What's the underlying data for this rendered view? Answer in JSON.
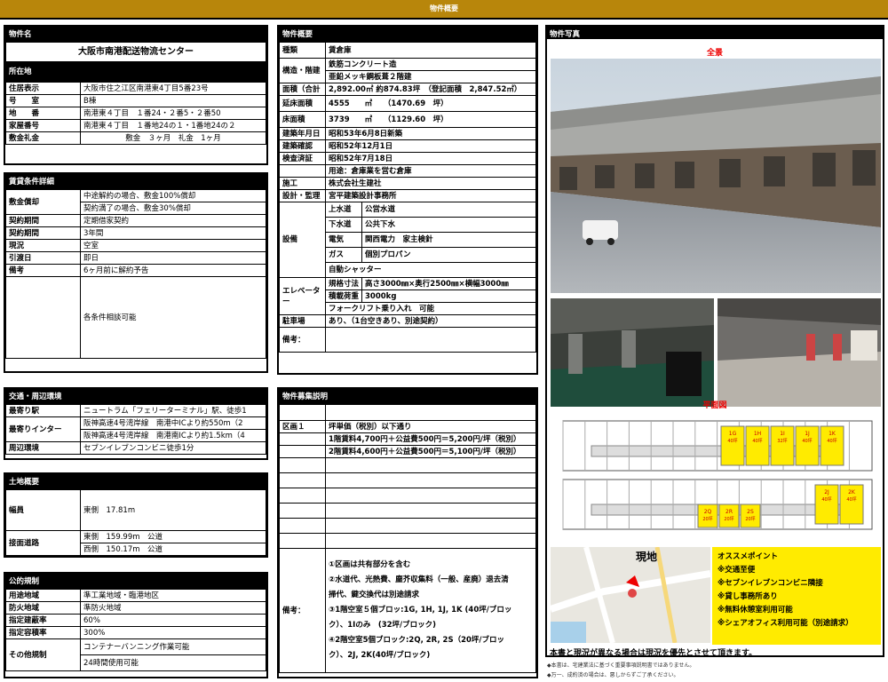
{
  "header": {
    "title": "物件概要"
  },
  "property_name": {
    "label": "物件名",
    "value": "大阪市南港配送物流センター"
  },
  "location": {
    "label": "所在地",
    "rows": [
      {
        "label": "住居表示",
        "value": "大阪市住之江区南港東4丁目5番23号"
      },
      {
        "label": "号　　室",
        "value": "B棟"
      },
      {
        "label": "地　　番",
        "value": "南港東４丁目　１番24・２番5・２番50"
      },
      {
        "label": "家屋番号",
        "value": "南港東４丁目　１番地24の１・1番地24の２"
      },
      {
        "label": "敷金礼金",
        "value": "敷金　３ヶ月　礼金　1ヶ月"
      }
    ]
  },
  "lease": {
    "title": "賃貸条件詳細",
    "deposit_label": "敷金償却",
    "deposit_lines": [
      "中途解約の場合、敷金100%償却",
      "契約満了の場合、敷金30%償却"
    ],
    "rows": [
      {
        "label": "契約期間",
        "value": "定期借家契約"
      },
      {
        "label": "契約期間",
        "value": "3年間"
      },
      {
        "label": "現況",
        "value": "空室"
      },
      {
        "label": "引渡日",
        "value": "即日"
      },
      {
        "label": "備考",
        "value": "6ヶ月前に解約予告"
      }
    ],
    "consult": "各条件相談可能"
  },
  "transport": {
    "title": "交通・周辺環境",
    "station_label": "最寄り駅",
    "station": "ニュートラム「フェリーターミナル」駅、徒歩1",
    "ic_label": "最寄りインター",
    "ic_lines": [
      "阪神高速4号湾岸線　南港中ICより約550m（2",
      "阪神高速4号湾岸線　南港南ICより約1.5km（4"
    ],
    "env_label": "周辺環境",
    "env": "セブンイレブンコンビニ徒歩1分"
  },
  "land": {
    "title": "土地概要",
    "width_label": "幅員",
    "width": "東側　17.81m",
    "road_label": "接面道路",
    "roads": [
      "東側　159.99m　公道",
      "西側　150.17m　公道"
    ]
  },
  "regulation": {
    "title": "公的規制",
    "rows": [
      {
        "label": "用途地域",
        "value": "準工業地域・臨港地区"
      },
      {
        "label": "防火地域",
        "value": "準防火地域"
      },
      {
        "label": "指定建蔽率",
        "value": "60%"
      },
      {
        "label": "指定容積率",
        "value": "300%"
      }
    ],
    "other_label": "その他規制",
    "other_lines": [
      "コンテナーバンニング作業可能",
      "24時間使用可能"
    ]
  },
  "overview": {
    "title": "物件概要",
    "type_label": "種類",
    "type": "賃倉庫",
    "structure_label": "構造・階建",
    "structure_lines": [
      "鉄筋コンクリート造",
      "亜鉛メッキ鋼板葺２階建"
    ],
    "area_label": "面積（合計",
    "area": "2,892.00㎡ 約874.83坪　（登記面積　2,847.52㎡）",
    "floor_area_label": "延床面積",
    "floor_area": "4555　　㎡　　（1470.69　坪）",
    "base_area_label": "床面積",
    "base_area": "3739　　㎡　　（1129.60　坪）",
    "built_label": "建築年月日",
    "built": "昭和53年6月8日新築",
    "confirm_label": "建築確認",
    "confirm": "昭和52年12月1日",
    "inspect_label": "検査済証",
    "inspect": "昭和52年7月18日",
    "use": "用途：倉庫業を営む倉庫",
    "builder_label": "施工",
    "builder": "株式会社生建社",
    "design_label": "設計・監理",
    "design": "宮平建築設計事務所",
    "equip_label": "設備",
    "equip": [
      {
        "k": "上水道",
        "v": "公営水道"
      },
      {
        "k": "下水道",
        "v": "公共下水"
      },
      {
        "k": "電気",
        "v": "関西電力　家主検針"
      },
      {
        "k": "ガス",
        "v": "個別プロパン"
      }
    ],
    "shutter": "自動シャッター",
    "elevator_label": "エレベーター",
    "elevator": [
      {
        "k": "規格寸法",
        "v": "高さ3000㎜×奥行2500㎜×横幅3000㎜"
      },
      {
        "k": "積載荷重",
        "v": "3000kg"
      }
    ],
    "forklift": "フォークリフト乗り入れ　可能",
    "parking_label": "駐車場",
    "parking": "あり、（1台空きあり、別途契約）",
    "remarks_label": "備考："
  },
  "recruit": {
    "title": "物件募集説明",
    "area_label": "区画１",
    "lines": [
      "坪単価（税別）以下通り",
      "1階賃料4,700円＋公益費500円＝5,200円/坪（税別）",
      "2階賃料4,600円＋公益費500円＝5,100円/坪（税別）"
    ],
    "remarks_label": "備考：",
    "remarks": [
      "①区画は共有部分を含む",
      "②水道代、光熱費、塵芥収集料（一般、産廃）退去清",
      "掃代、鍵交換代は別途請求",
      "③1階空室５個ブロッ:1G, 1H, 1J, 1K (40坪/ブロッ",
      "ク）、1Iのみ　(32坪/ブロック)",
      "④2階空室5個ブロック:2Q, 2R, 2S（20坪/ブロッ",
      "ク）、2J, 2K(40坪/ブロック)"
    ]
  },
  "photos": {
    "title": "物件写真",
    "overview_label": "全景",
    "floor_label": "平面図",
    "map_label": "現地",
    "plan_1f": [
      {
        "id": "1G",
        "s": "40坪"
      },
      {
        "id": "1H",
        "s": "40坪"
      },
      {
        "id": "1I",
        "s": "32坪"
      },
      {
        "id": "1J",
        "s": "40坪"
      },
      {
        "id": "1K",
        "s": "40坪"
      }
    ],
    "plan_2f": [
      {
        "id": "2J",
        "s": "40坪"
      },
      {
        "id": "2K",
        "s": "40坪"
      },
      {
        "id": "2Q",
        "s": "20坪"
      },
      {
        "id": "2R",
        "s": "20坪"
      },
      {
        "id": "2S",
        "s": "20坪"
      }
    ]
  },
  "recommend": {
    "title": "オススメポイント",
    "items": [
      "※交通至便",
      "※セブンイレブンコンビニ隣接",
      "※貸し事務所あり",
      "※無料休憩室利用可能",
      "※シェアオフィス利用可能（別途請求）"
    ]
  },
  "footer": {
    "main": "本書と現況が異なる場合は現況を優先とさせて頂きます。",
    "note1": "◆本書は、宅建業法に基づく重要事項説明書ではありません。",
    "note2": "◆万一、成約済の場合は、悪しからずご了承ください。"
  },
  "colors": {
    "gold": "#b8860b",
    "yellow": "#ffeb00",
    "red": "#e00000"
  }
}
